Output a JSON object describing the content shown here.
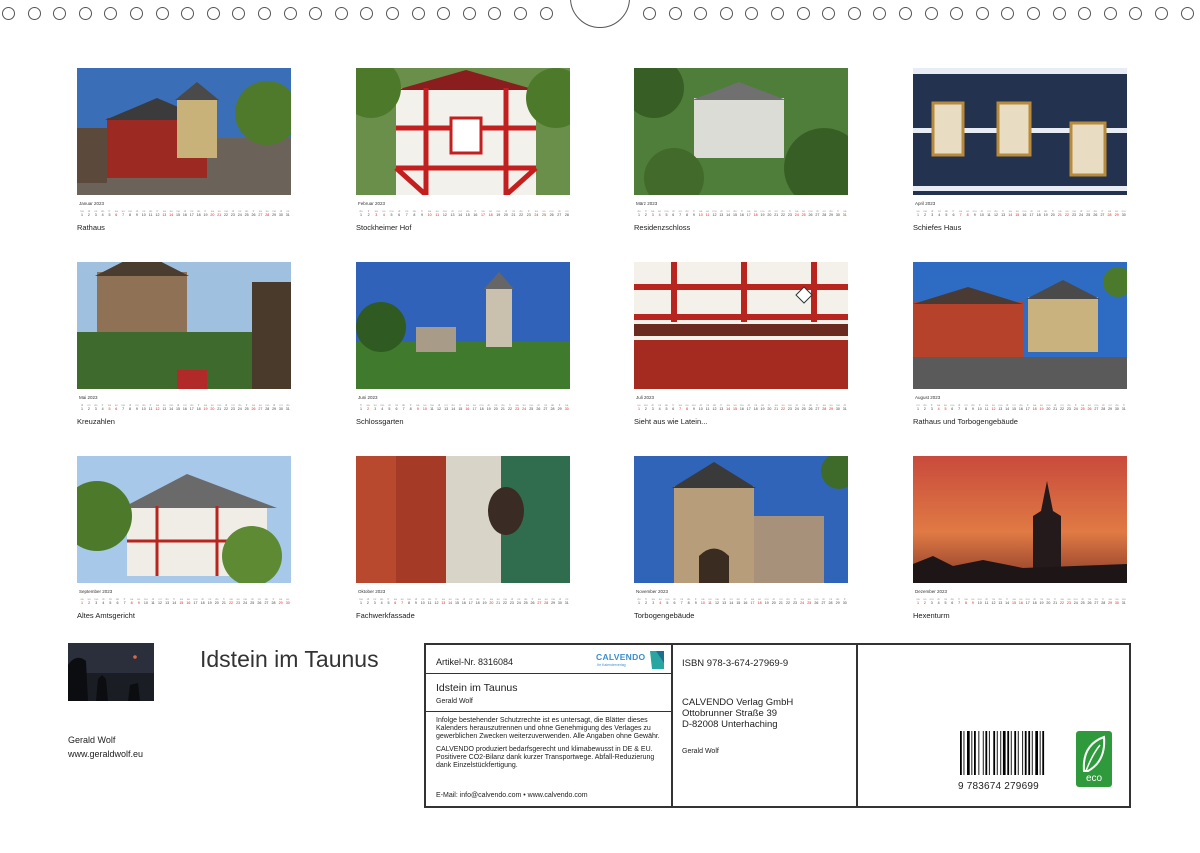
{
  "months": [
    {
      "name": "Januar 2023",
      "caption": "Rathaus",
      "days": 31,
      "start": 0
    },
    {
      "name": "Februar 2023",
      "caption": "Stockheimer Hof",
      "days": 28,
      "start": 3
    },
    {
      "name": "März 2023",
      "caption": "Residenzschloss",
      "days": 31,
      "start": 3
    },
    {
      "name": "April 2023",
      "caption": "Schiefes Haus",
      "days": 30,
      "start": 6
    },
    {
      "name": "Mai 2023",
      "caption": "Kreuzahlen",
      "days": 31,
      "start": 1
    },
    {
      "name": "Juni 2023",
      "caption": "Schlossgarten",
      "days": 30,
      "start": 4
    },
    {
      "name": "Juli 2023",
      "caption": "Sieht aus wie Latein...",
      "days": 31,
      "start": 6
    },
    {
      "name": "August 2023",
      "caption": "Rathaus und Torbogengebäude",
      "days": 31,
      "start": 2
    },
    {
      "name": "September 2023",
      "caption": "Altes Amtsgericht",
      "days": 30,
      "start": 5
    },
    {
      "name": "Oktober 2023",
      "caption": "Fachwerkfassade",
      "days": 31,
      "start": 0
    },
    {
      "name": "November 2023",
      "caption": "Torbogengebäude",
      "days": 30,
      "start": 3
    },
    {
      "name": "Dezember 2023",
      "caption": "Hexenturm",
      "days": 31,
      "start": 5
    }
  ],
  "weekday_abbr": [
    "Mo",
    "Di",
    "Mi",
    "Do",
    "Fr",
    "Sa",
    "So"
  ],
  "title": "Idstein im Taunus",
  "author": {
    "name": "Gerald Wolf",
    "url": "www.geraldwolf.eu"
  },
  "info": {
    "article": "Artikel-Nr. 8316084",
    "logo_text": "CALVENDO",
    "logo_sub": "Ihr Kalenderverlag",
    "book_title": "Idstein im Taunus",
    "book_author": "Gerald Wolf",
    "legal1": "Infolge bestehender Schutzrechte ist es untersagt, die Blätter dieses Kalenders herauszutrennen und ohne Genehmigung des Verlages zu gewerblichen Zwecken weiterzuverwenden. Alle Angaben ohne Gewähr.",
    "legal2": "CALVENDO produziert bedarfsgerecht und klimabewusst in DE & EU. Positivere CO2-Bilanz dank kurzer Transportwege. Abfall-Reduzierung dank Einzelstückfertigung.",
    "email": "E-Mail: info@calvendo.com • www.calvendo.com",
    "isbn": "ISBN 978-3-674-27969-9",
    "publisher_name": "CALVENDO Verlag GmbH",
    "publisher_street": "Ottobrunner Straße 39",
    "publisher_city": "D-82008 Unterhaching",
    "publisher_author": "Gerald Wolf",
    "barcode_number": "9 783674 279699",
    "eco_label": "eco"
  }
}
